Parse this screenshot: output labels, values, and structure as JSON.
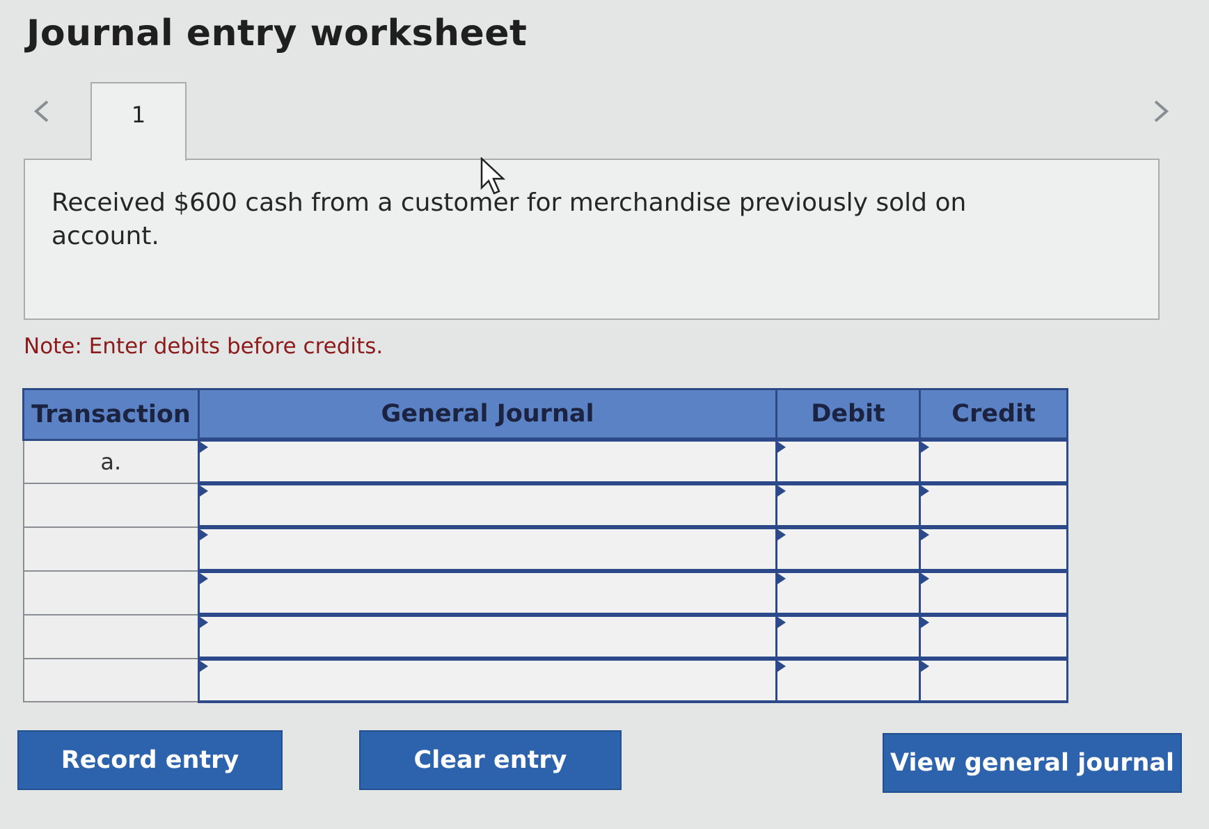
{
  "page": {
    "title": "Journal entry worksheet"
  },
  "navigation": {
    "prev_icon": "chevron-left-icon",
    "next_icon": "chevron-right-icon",
    "tabs": [
      {
        "label": "1",
        "active": true
      }
    ]
  },
  "question": {
    "text": "Received $600 cash from a customer for merchandise previously sold on account."
  },
  "note": {
    "text": "Note: Enter debits before credits."
  },
  "journal_table": {
    "headers": {
      "transaction": "Transaction",
      "general_journal": "General Journal",
      "debit": "Debit",
      "credit": "Credit"
    },
    "rows": [
      {
        "transaction": "a.",
        "account": "",
        "debit": "",
        "credit": ""
      },
      {
        "transaction": "",
        "account": "",
        "debit": "",
        "credit": ""
      },
      {
        "transaction": "",
        "account": "",
        "debit": "",
        "credit": ""
      },
      {
        "transaction": "",
        "account": "",
        "debit": "",
        "credit": ""
      },
      {
        "transaction": "",
        "account": "",
        "debit": "",
        "credit": ""
      },
      {
        "transaction": "",
        "account": "",
        "debit": "",
        "credit": ""
      }
    ]
  },
  "buttons": {
    "record": "Record entry",
    "clear": "Clear entry",
    "view": "View general journal"
  },
  "colors": {
    "header_bg": "#5a82c4",
    "button_bg": "#2d62ad",
    "note_text": "#8c1c1c",
    "entry_border": "#2c4a8a"
  }
}
